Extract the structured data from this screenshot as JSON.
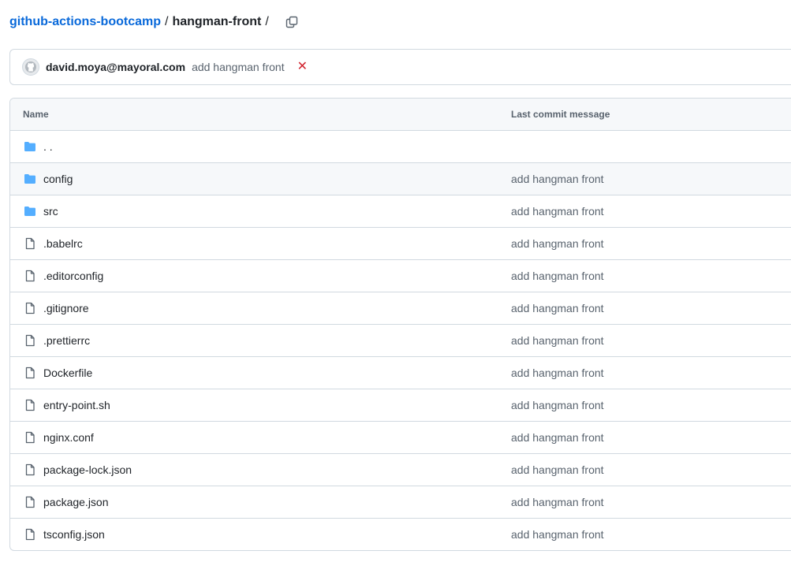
{
  "breadcrumb": {
    "repo": "github-actions-bootcamp",
    "separator": "/",
    "directory": "hangman-front",
    "trailing_separator": "/"
  },
  "commit": {
    "author": "david.moya@mayoral.com",
    "message": "add hangman front",
    "status_icon": "x-icon",
    "status_color": "#d1242f"
  },
  "table": {
    "headers": {
      "name": "Name",
      "message": "Last commit message"
    },
    "parent": {
      "name": ". .",
      "icon": "folder-icon"
    },
    "rows": [
      {
        "name": "config",
        "type": "folder",
        "message": "add hangman front"
      },
      {
        "name": "src",
        "type": "folder",
        "message": "add hangman front"
      },
      {
        "name": ".babelrc",
        "type": "file",
        "message": "add hangman front"
      },
      {
        "name": ".editorconfig",
        "type": "file",
        "message": "add hangman front"
      },
      {
        "name": ".gitignore",
        "type": "file",
        "message": "add hangman front"
      },
      {
        "name": ".prettierrc",
        "type": "file",
        "message": "add hangman front"
      },
      {
        "name": "Dockerfile",
        "type": "file",
        "message": "add hangman front"
      },
      {
        "name": "entry-point.sh",
        "type": "file",
        "message": "add hangman front"
      },
      {
        "name": "nginx.conf",
        "type": "file",
        "message": "add hangman front"
      },
      {
        "name": "package-lock.json",
        "type": "file",
        "message": "add hangman front"
      },
      {
        "name": "package.json",
        "type": "file",
        "message": "add hangman front"
      },
      {
        "name": "tsconfig.json",
        "type": "file",
        "message": "add hangman front"
      }
    ]
  },
  "colors": {
    "link": "#0969da",
    "folder": "#54aeff",
    "muted": "#59636e",
    "border": "#d1d9e0"
  }
}
